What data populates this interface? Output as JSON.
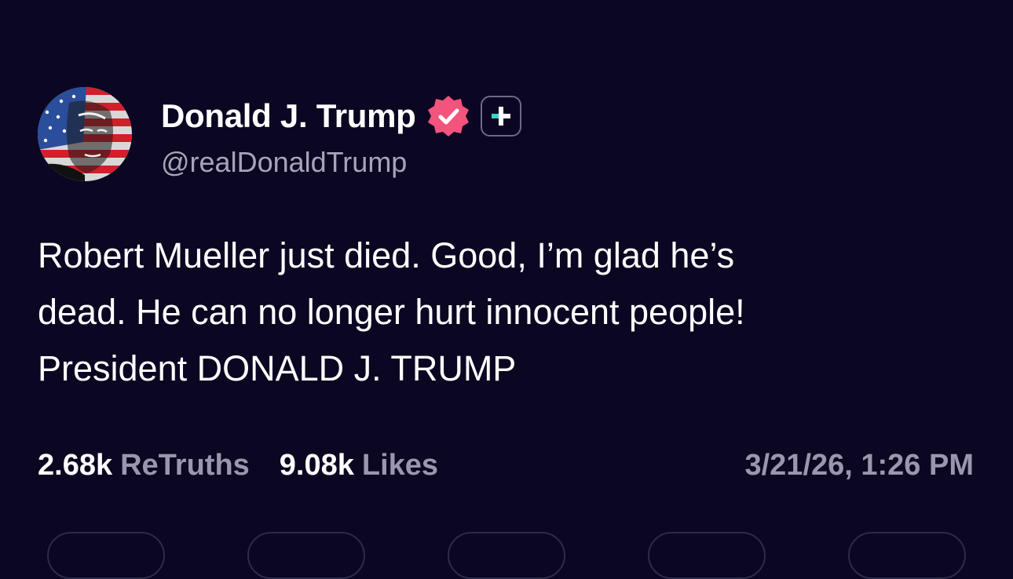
{
  "author": {
    "display_name": "Donald J. Trump",
    "handle": "@realDonaldTrump",
    "verified_color": "#f2547d",
    "badge_icon": "plus-badge-icon",
    "avatar_icon": "avatar-flag-portrait"
  },
  "post": {
    "lines": [
      "Robert Mueller just died. Good, I’m glad he’s",
      "dead. He can no longer hurt innocent people!",
      "President DONALD J. TRUMP"
    ]
  },
  "stats": {
    "retruths_count": "2.68k",
    "retruths_label": "ReTruths",
    "likes_count": "9.08k",
    "likes_label": "Likes"
  },
  "timestamp": "3/21/26, 1:26 PM",
  "colors": {
    "background": "#0b0722",
    "muted_text": "#9a96b0",
    "accent_teal": "#3fd0c9"
  }
}
